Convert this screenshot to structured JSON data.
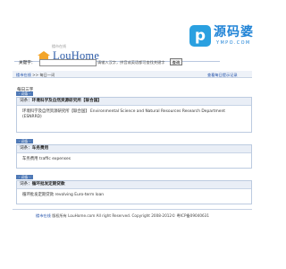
{
  "logo": {
    "text": "LouHome",
    "cn": "楼市在线"
  },
  "watermark": {
    "badge": "p",
    "text": "源码婆",
    "sub": "YMPO.COM"
  },
  "search": {
    "label": "关键字：",
    "value": "",
    "hint": "请输入汉字，拼音或英语都可查找关键字",
    "button": "查询"
  },
  "nav": {
    "site": "楼市在线",
    "crumb": "每日一词",
    "separator": " >> ",
    "right": "查看每日提示记录"
  },
  "day_title": "每日三字",
  "entries": [
    {
      "tag": "· 词条 ·",
      "prefix": "词条：",
      "term": "环境科学及自然资源研究所【联合国】",
      "body": "环境科学及自然资源研究所【联合国】 Environmental Science and Natural Resources Research Department (ESNRRD)"
    },
    {
      "tag": "· 词条 ·",
      "prefix": "词条：",
      "term": "车务费用",
      "body": "车务费用  traffic expenses"
    },
    {
      "tag": "· 词条 ·",
      "prefix": "词条：",
      "term": "循环批发定期贷款",
      "body": "循环批发定期贷款  revolving Euro-term loan"
    }
  ],
  "footer": {
    "link": "楼市在线",
    "text": "  版权所有  LouHome.com All right Reserved. Copyright 2008-2012© 粤ICP备09040631"
  }
}
